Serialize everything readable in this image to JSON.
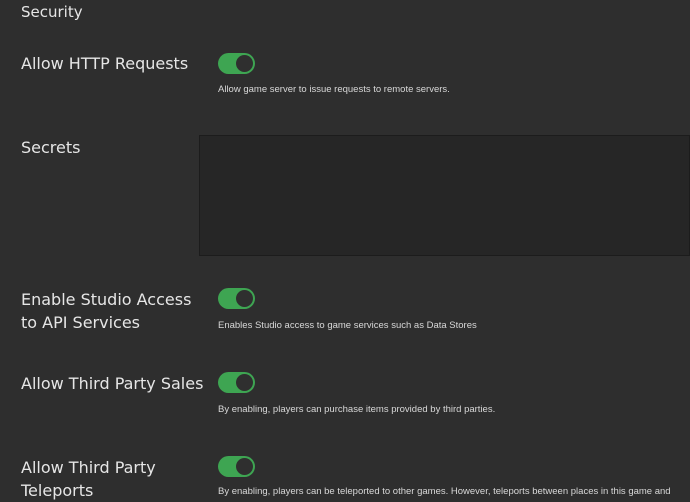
{
  "section_title": "Security",
  "settings": [
    {
      "label": "Allow HTTP Requests",
      "enabled": true,
      "description": "Allow game server to issue requests to remote servers."
    },
    {
      "label": "Secrets",
      "value": ""
    },
    {
      "label": "Enable Studio Access to API Services",
      "enabled": true,
      "description": "Enables Studio access to game services such as Data Stores"
    },
    {
      "label": "Allow Third Party Sales",
      "enabled": true,
      "description": "By enabling, players can purchase items provided by third parties."
    },
    {
      "label": "Allow Third Party Teleports",
      "enabled": true,
      "description": "By enabling, players can be teleported to other games. However, teleports between places in this game and"
    }
  ],
  "colors": {
    "toggle_on": "#3ea552",
    "background": "#2e2e2e"
  }
}
